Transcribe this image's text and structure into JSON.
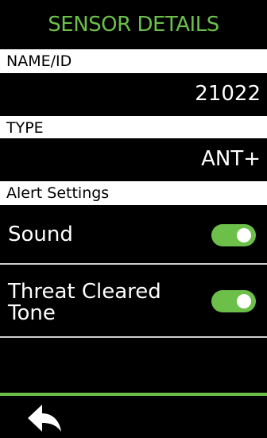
{
  "header": {
    "title": "SENSOR DETAILS"
  },
  "sections": {
    "name_id": {
      "label": "NAME/ID",
      "value": "21022"
    },
    "type": {
      "label": "TYPE",
      "value": "ANT+"
    },
    "alert_settings": {
      "label": "Alert Settings"
    }
  },
  "settings": [
    {
      "label": "Sound",
      "enabled": true
    },
    {
      "label": "Threat Cleared Tone",
      "enabled": true
    }
  ],
  "footer": {
    "back_icon": "back-arrow-icon"
  },
  "colors": {
    "accent": "#6cc04a",
    "background": "#000000",
    "label_bar": "#ffffff"
  }
}
